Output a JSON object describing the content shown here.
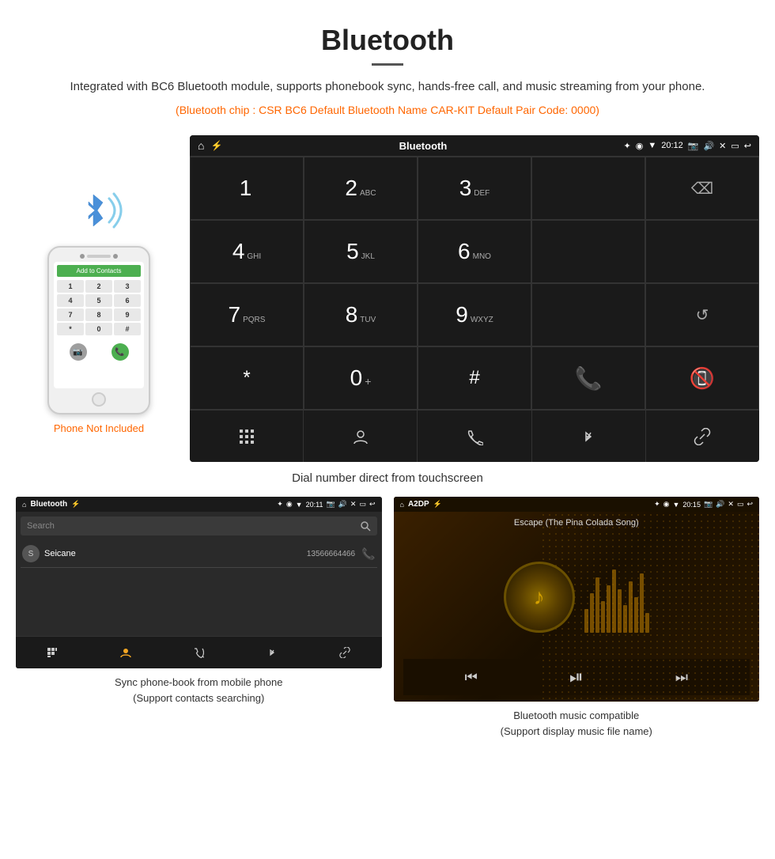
{
  "header": {
    "title": "Bluetooth",
    "description": "Integrated with BC6 Bluetooth module, supports phonebook sync, hands-free call, and music streaming from your phone.",
    "specs": "(Bluetooth chip : CSR BC6    Default Bluetooth Name CAR-KIT    Default Pair Code: 0000)"
  },
  "device_screen": {
    "status_bar": {
      "title": "Bluetooth",
      "time": "20:12",
      "icons": [
        "bt",
        "location",
        "wifi",
        "camera",
        "volume",
        "x",
        "rect",
        "back"
      ]
    },
    "dialpad": {
      "keys": [
        {
          "number": "1",
          "sub": ""
        },
        {
          "number": "2",
          "sub": "ABC"
        },
        {
          "number": "3",
          "sub": "DEF"
        },
        {
          "number": "",
          "sub": ""
        },
        {
          "number": "",
          "sub": "backspace"
        },
        {
          "number": "4",
          "sub": "GHI"
        },
        {
          "number": "5",
          "sub": "JKL"
        },
        {
          "number": "6",
          "sub": "MNO"
        },
        {
          "number": "",
          "sub": ""
        },
        {
          "number": "",
          "sub": ""
        },
        {
          "number": "7",
          "sub": "PQRS"
        },
        {
          "number": "8",
          "sub": "TUV"
        },
        {
          "number": "9",
          "sub": "WXYZ"
        },
        {
          "number": "",
          "sub": ""
        },
        {
          "number": "",
          "sub": "refresh"
        },
        {
          "number": "*",
          "sub": ""
        },
        {
          "number": "0",
          "sub": "+"
        },
        {
          "number": "#",
          "sub": ""
        },
        {
          "number": "",
          "sub": "call-green"
        },
        {
          "number": "",
          "sub": "call-red"
        }
      ]
    },
    "toolbar": {
      "buttons": [
        "dialpad",
        "contact",
        "phone",
        "bluetooth",
        "link"
      ]
    }
  },
  "caption": "Dial number direct from touchscreen",
  "phone_label": "Phone Not Included",
  "phone_screen": {
    "header": "Add to Contacts",
    "keys": [
      "1",
      "2",
      "3",
      "4",
      "5",
      "6",
      "7",
      "8",
      "9",
      "*",
      "0",
      "#"
    ]
  },
  "bottom_left": {
    "status": {
      "title": "Bluetooth",
      "time": "20:11"
    },
    "search_placeholder": "Search",
    "contact": {
      "initial": "S",
      "name": "Seicane",
      "number": "13566664466"
    },
    "toolbar_buttons": [
      "apps",
      "contact",
      "phone",
      "bluetooth",
      "link"
    ],
    "caption_line1": "Sync phone-book from mobile phone",
    "caption_line2": "(Support contacts searching)"
  },
  "bottom_right": {
    "status": {
      "title": "A2DP",
      "time": "20:15"
    },
    "song_title": "Escape (The Pina Colada Song)",
    "controls": [
      "skip-back",
      "play-pause",
      "skip-forward"
    ],
    "caption_line1": "Bluetooth music compatible",
    "caption_line2": "(Support display music file name)"
  }
}
